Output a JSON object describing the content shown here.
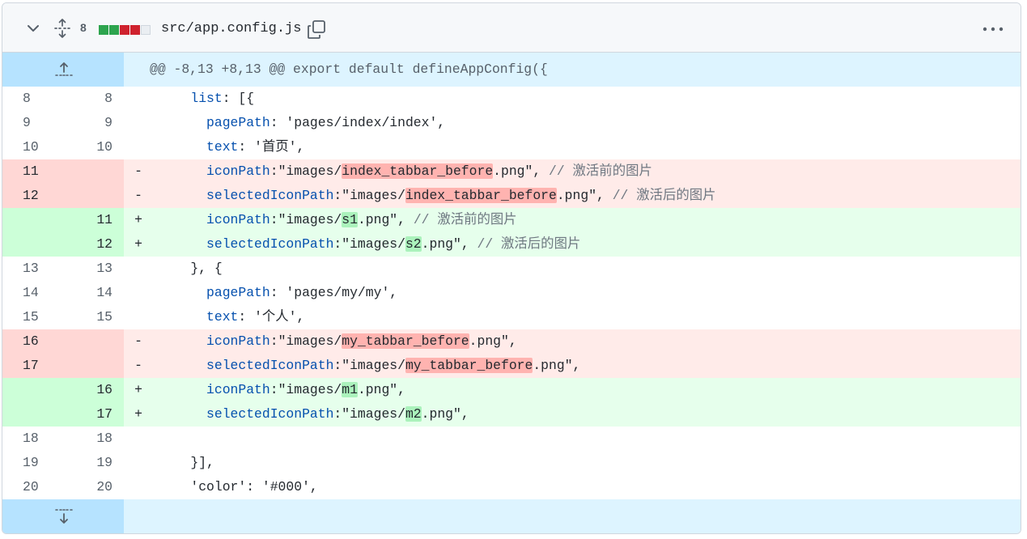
{
  "header": {
    "changes_count": "8",
    "file_path": "src/app.config.js",
    "icons": [
      "chevron-down-icon",
      "expand-all-icon",
      "copy-icon",
      "kebab-menu-icon"
    ],
    "diffstat_colors": [
      "#2da44e",
      "#2da44e",
      "#cf222e",
      "#cf222e",
      "#eaeef2"
    ]
  },
  "hunk": {
    "header_text": "@@ -8,13 +8,13 @@ export default defineAppConfig({"
  },
  "lines": [
    {
      "old": "8",
      "new": "8",
      "marker": "",
      "type": "ctx",
      "indent": "    ",
      "key": "list",
      "rest": ": [{"
    },
    {
      "old": "9",
      "new": "9",
      "marker": "",
      "type": "ctx",
      "indent": "      ",
      "key": "pagePath",
      "rest": ": 'pages/index/index',"
    },
    {
      "old": "10",
      "new": "10",
      "marker": "",
      "type": "ctx",
      "indent": "      ",
      "key": "text",
      "rest": ": '首页',"
    },
    {
      "old": "11",
      "new": "",
      "marker": "-",
      "type": "del",
      "indent": "      ",
      "key": "iconPath",
      "pre": ":\"images/",
      "hl": "index_tabbar_before",
      "post": ".png\", ",
      "comment": "// 激活前的图片"
    },
    {
      "old": "12",
      "new": "",
      "marker": "-",
      "type": "del",
      "indent": "      ",
      "key": "selectedIconPath",
      "pre": ":\"images/",
      "hl": "index_tabbar_before",
      "post": ".png\", ",
      "comment": "// 激活后的图片"
    },
    {
      "old": "",
      "new": "11",
      "marker": "+",
      "type": "add",
      "indent": "      ",
      "key": "iconPath",
      "pre": ":\"images/",
      "hl": "s1",
      "post": ".png\", ",
      "comment": "// 激活前的图片"
    },
    {
      "old": "",
      "new": "12",
      "marker": "+",
      "type": "add",
      "indent": "      ",
      "key": "selectedIconPath",
      "pre": ":\"images/",
      "hl": "s2",
      "post": ".png\", ",
      "comment": "// 激活后的图片"
    },
    {
      "old": "13",
      "new": "13",
      "marker": "",
      "type": "ctx",
      "indent": "    ",
      "key": "",
      "rest": "}, {"
    },
    {
      "old": "14",
      "new": "14",
      "marker": "",
      "type": "ctx",
      "indent": "      ",
      "key": "pagePath",
      "rest": ": 'pages/my/my',"
    },
    {
      "old": "15",
      "new": "15",
      "marker": "",
      "type": "ctx",
      "indent": "      ",
      "key": "text",
      "rest": ": '个人',"
    },
    {
      "old": "16",
      "new": "",
      "marker": "-",
      "type": "del",
      "indent": "      ",
      "key": "iconPath",
      "pre": ":\"images/",
      "hl": "my_tabbar_before",
      "post": ".png\",",
      "comment": ""
    },
    {
      "old": "17",
      "new": "",
      "marker": "-",
      "type": "del",
      "indent": "      ",
      "key": "selectedIconPath",
      "pre": ":\"images/",
      "hl": "my_tabbar_before",
      "post": ".png\",",
      "comment": ""
    },
    {
      "old": "",
      "new": "16",
      "marker": "+",
      "type": "add",
      "indent": "      ",
      "key": "iconPath",
      "pre": ":\"images/",
      "hl": "m1",
      "post": ".png\",",
      "comment": ""
    },
    {
      "old": "",
      "new": "17",
      "marker": "+",
      "type": "add",
      "indent": "      ",
      "key": "selectedIconPath",
      "pre": ":\"images/",
      "hl": "m2",
      "post": ".png\",",
      "comment": ""
    },
    {
      "old": "18",
      "new": "18",
      "marker": "",
      "type": "ctx",
      "indent": "",
      "key": "",
      "rest": ""
    },
    {
      "old": "19",
      "new": "19",
      "marker": "",
      "type": "ctx",
      "indent": "    ",
      "key": "",
      "rest": "}],"
    },
    {
      "old": "20",
      "new": "20",
      "marker": "",
      "type": "ctx",
      "indent": "    ",
      "key": "",
      "rest": "'color': '#000',"
    }
  ]
}
